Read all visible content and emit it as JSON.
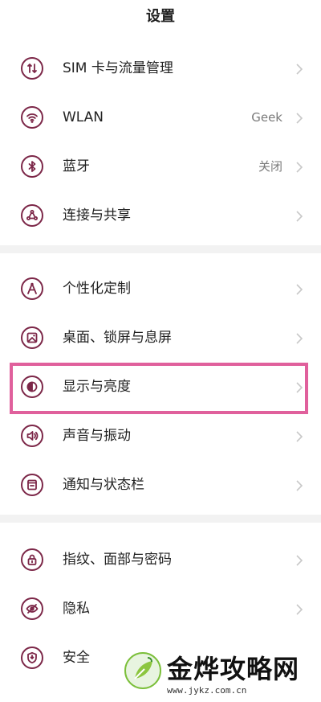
{
  "header": {
    "title": "设置"
  },
  "groups": [
    {
      "items": [
        {
          "label": "SIM 卡与流量管理",
          "value": "",
          "icon": "sim-data-icon"
        },
        {
          "label": "WLAN",
          "value": "Geek",
          "icon": "wifi-icon"
        },
        {
          "label": "蓝牙",
          "value": "关闭",
          "icon": "bluetooth-icon"
        },
        {
          "label": "连接与共享",
          "value": "",
          "icon": "share-icon"
        }
      ]
    },
    {
      "items": [
        {
          "label": "个性化定制",
          "value": "",
          "icon": "personalize-icon"
        },
        {
          "label": "桌面、锁屏与息屏",
          "value": "",
          "icon": "wallpaper-icon"
        },
        {
          "label": "显示与亮度",
          "value": "",
          "icon": "brightness-icon",
          "highlighted": true
        },
        {
          "label": "声音与振动",
          "value": "",
          "icon": "speaker-icon"
        },
        {
          "label": "通知与状态栏",
          "value": "",
          "icon": "notification-icon"
        }
      ]
    },
    {
      "items": [
        {
          "label": "指纹、面部与密码",
          "value": "",
          "icon": "lock-icon"
        },
        {
          "label": "隐私",
          "value": "",
          "icon": "privacy-eye-icon"
        },
        {
          "label": "安全",
          "value": "",
          "icon": "shield-icon"
        }
      ]
    }
  ],
  "colors": {
    "icon": "#7c2748",
    "highlight": "#e0609c",
    "chevron": "#c8c8c8"
  },
  "watermark": {
    "title": "金烨攻略网",
    "url": "www.jykz.com.cn"
  }
}
